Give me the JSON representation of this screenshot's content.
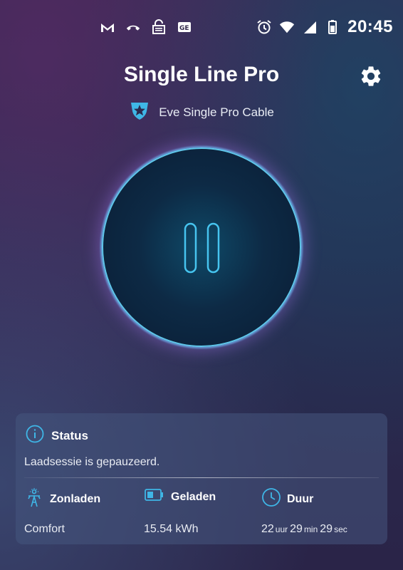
{
  "status_bar": {
    "time": "20:45",
    "left_icons": [
      "gmail-icon",
      "missed-call-icon",
      "vpn-lock-icon",
      "news-icon"
    ],
    "right_icons": [
      "alarm-icon",
      "wifi-icon",
      "signal-icon",
      "battery-icon"
    ]
  },
  "header": {
    "title": "Single Line Pro",
    "device_name": "Eve Single Pro Cable"
  },
  "control": {
    "state": "paused",
    "icon": "pause-icon"
  },
  "status_card": {
    "title": "Status",
    "message": "Laadsessie is gepauzeerd.",
    "solar": {
      "label": "Zonladen",
      "value": "Comfort"
    },
    "charged": {
      "label": "Geladen",
      "value": "15.54 kWh"
    },
    "duration": {
      "label": "Duur",
      "hours": "22",
      "hours_unit": "uur",
      "minutes": "29",
      "minutes_unit": "min",
      "seconds": "29",
      "seconds_unit": "sec"
    }
  },
  "colors": {
    "accent": "#3fb6e6",
    "card_bg": "#46557d"
  }
}
